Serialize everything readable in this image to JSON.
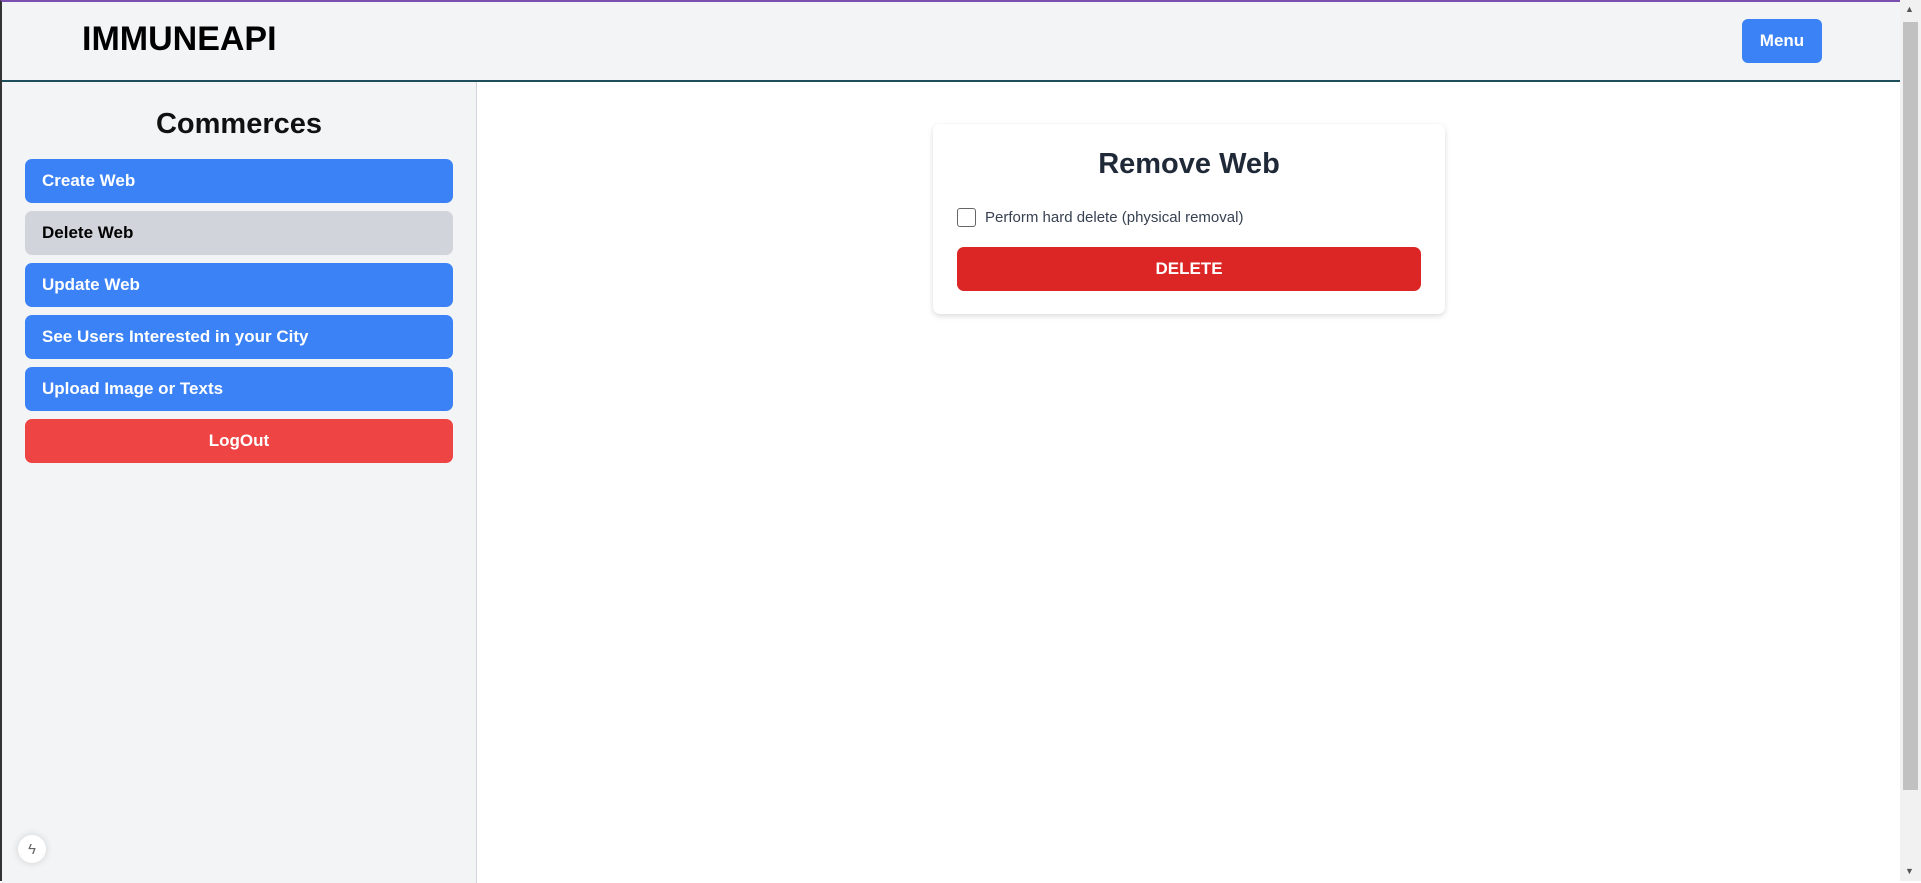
{
  "header": {
    "brand": "IMMUNEAPI",
    "menu_label": "Menu"
  },
  "sidebar": {
    "title": "Commerces",
    "items": [
      {
        "label": "Create Web",
        "active": false
      },
      {
        "label": "Delete Web",
        "active": true
      },
      {
        "label": "Update Web",
        "active": false
      },
      {
        "label": "See Users Interested in your City",
        "active": false
      },
      {
        "label": "Upload Image or Texts",
        "active": false
      }
    ],
    "logout_label": "LogOut"
  },
  "main": {
    "card_title": "Remove Web",
    "hard_delete_label": "Perform hard delete (physical removal)",
    "hard_delete_checked": false,
    "delete_label": "DELETE"
  },
  "colors": {
    "primary": "#3b82f6",
    "danger": "#dc2626",
    "logout": "#ef4444",
    "active": "#d1d5db"
  },
  "icons": {
    "floating": "lightning-bolt-icon"
  }
}
